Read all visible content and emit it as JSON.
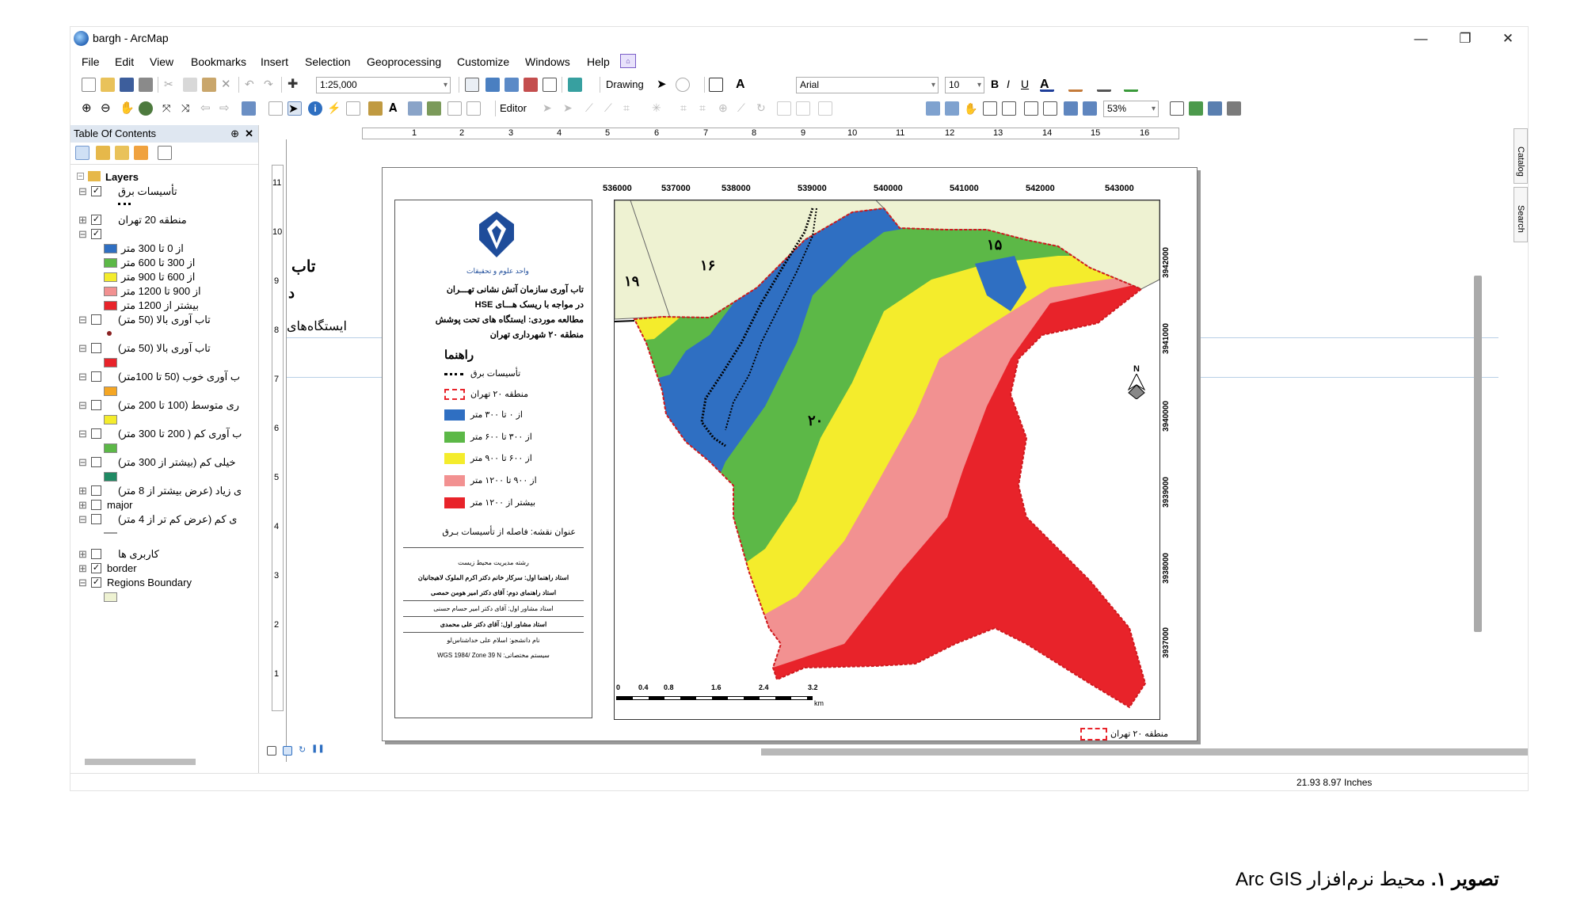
{
  "window": {
    "title": "bargh - ArcMap",
    "minimize": "—",
    "maximize": "❐",
    "close": "✕"
  },
  "menu": [
    "File",
    "Edit",
    "View",
    "Bookmarks",
    "Insert",
    "Selection",
    "Geoprocessing",
    "Customize",
    "Windows",
    "Help"
  ],
  "toolbar": {
    "scale": "1:25,000",
    "drawing_label": "Drawing",
    "font": "Arial",
    "font_size": "10",
    "bold": "B",
    "italic": "I",
    "underline": "U",
    "editor_label": "Editor",
    "zoom": "53%"
  },
  "toc": {
    "title": "Table Of Contents",
    "pin": "⊕",
    "close": "✕",
    "root": "Layers",
    "items": [
      {
        "label": "تأسیسات برق",
        "checked": true,
        "expand": "⊟"
      },
      {
        "label": "منطقه 20 تهران",
        "checked": true,
        "expand": "⊞"
      },
      {
        "label": "",
        "checked": true,
        "expand": "⊟"
      },
      {
        "label": "از 0 تا 300 متر",
        "color": "#2f6fc2"
      },
      {
        "label": "از 300 تا 600 متر",
        "color": "#5cb847"
      },
      {
        "label": "از 600 تا 900 متر",
        "color": "#f4ec2c"
      },
      {
        "label": "از 900 تا 1200 متر",
        "color": "#f29191"
      },
      {
        "label": "بیشتر از 1200 متر",
        "color": "#e8232a"
      },
      {
        "label": "تاب آوری بالا (50 متر)",
        "checked": false,
        "expand": "⊟"
      },
      {
        "label": "تاب آوری بالا (50 متر)",
        "checked": false,
        "expand": "⊟",
        "color": "#e8232a"
      },
      {
        "label": "ب آوری خوب (50 تا 100متر)",
        "checked": false,
        "expand": "⊟",
        "color": "#f5a623"
      },
      {
        "label": "ری متوسط (100 تا 200 متر)",
        "checked": false,
        "expand": "⊟",
        "color": "#f4ec2c"
      },
      {
        "label": "ب آوری کم ( 200 تا 300 متر)",
        "checked": false,
        "expand": "⊟",
        "color": "#5cb847"
      },
      {
        "label": "خیلی کم (بیشتر از 300 متر)",
        "checked": false,
        "expand": "⊟",
        "color": "#1f8a63"
      },
      {
        "label": "ی زیاد (عرض بیشتر از 8 متر)",
        "checked": false,
        "expand": "⊞"
      },
      {
        "label": "major",
        "checked": false,
        "expand": "⊞"
      },
      {
        "label": "ی کم (عرض کم تر از 4 متر)",
        "checked": false,
        "expand": "⊟"
      },
      {
        "label": "کاربری ها",
        "checked": false,
        "expand": "⊞"
      },
      {
        "label": "border",
        "checked": true,
        "expand": "⊞"
      },
      {
        "label": "Regions Boundary",
        "checked": true,
        "expand": "⊟",
        "color": "#eef2d2"
      }
    ]
  },
  "ruler_h": [
    "1",
    "2",
    "3",
    "4",
    "5",
    "6",
    "7",
    "8",
    "9",
    "10",
    "11",
    "12",
    "13",
    "14",
    "15",
    "16"
  ],
  "ruler_v": [
    "11",
    "10",
    "9",
    "8",
    "7",
    "6",
    "5",
    "4",
    "3",
    "2",
    "1"
  ],
  "side_text": {
    "a": "تاب",
    "b": "د",
    "c": "ایستگاه‌های"
  },
  "legend": {
    "title_lines": [
      "تاب آوری سازمان آتش نشانی تهـــران",
      "در مواجه با ریسک هـــای HSE",
      "مطالعه موردی: ایستگاه های تحت پوشش",
      "منطقه ۲۰ شهرداری تهران"
    ],
    "guide": "راهنما",
    "univ": "واحد علوم و تحقیقات",
    "items": [
      {
        "label": "تأسیسات برق"
      },
      {
        "label": "منطقه ۲۰ تهران"
      },
      {
        "label": "از ۰ تا ۳۰۰ متر",
        "color": "#2f6fc2"
      },
      {
        "label": "از ۳۰۰ تا ۶۰۰ متر",
        "color": "#5cb847"
      },
      {
        "label": "از ۶۰۰ تا ۹۰۰ متر",
        "color": "#f4ec2c"
      },
      {
        "label": "از ۹۰۰ تا ۱۲۰۰ متر",
        "color": "#f29191"
      },
      {
        "label": "بیشتر از ۱۲۰۰ متر",
        "color": "#e8232a"
      }
    ],
    "map_title": "عنوان نقشه: فاصله از تأسیسات بـرق",
    "credits": [
      "رشته مدیریت محیط زیست",
      "استاد راهنما اول: سرکار خانم دکتر اکرم الملوک لاهیجانیان",
      "استاد راهنمای دوم: آقای دکتر امیر هومن حمصی",
      "استاد مشاور اول: آقای دکتر امیر حسام حسنی",
      "استاد مشاور اول: آقای دکتر علی محمدی",
      "نام دانشجو: اسلام علی خداشناس‌لو",
      "سیستم مختصاتی: WGS 1984/ Zone 39 N"
    ]
  },
  "map": {
    "x_ticks": [
      "536000",
      "537000",
      "538000",
      "539000",
      "540000",
      "541000",
      "542000",
      "543000"
    ],
    "y_ticks": [
      "3942000",
      "3941000",
      "3940000",
      "3939000",
      "3938000",
      "3937000"
    ],
    "region_labels": {
      "r15": "۱۵",
      "r16": "۱۶",
      "r19": "۱۹",
      "r20": "۲۰"
    },
    "north": "N",
    "scale_ticks": [
      "0",
      "0.4",
      "0.8",
      "1.6",
      "2.4",
      "3.2"
    ],
    "scale_unit": "km",
    "outside_legend": "منطقه ۲۰ تهران"
  },
  "status": {
    "coords": "21.93  8.97 Inches"
  },
  "dock": {
    "catalog": "Catalog",
    "search": "Search"
  },
  "caption": {
    "bold": "تصویر ۱.",
    "rest": " محیط نرم‌افزار Arc GIS"
  },
  "colors": {
    "blue": "#2f6fc2",
    "green": "#5cb847",
    "yellow": "#f4ec2c",
    "pink": "#f29191",
    "red": "#e8232a",
    "region": "#eef2d2"
  }
}
